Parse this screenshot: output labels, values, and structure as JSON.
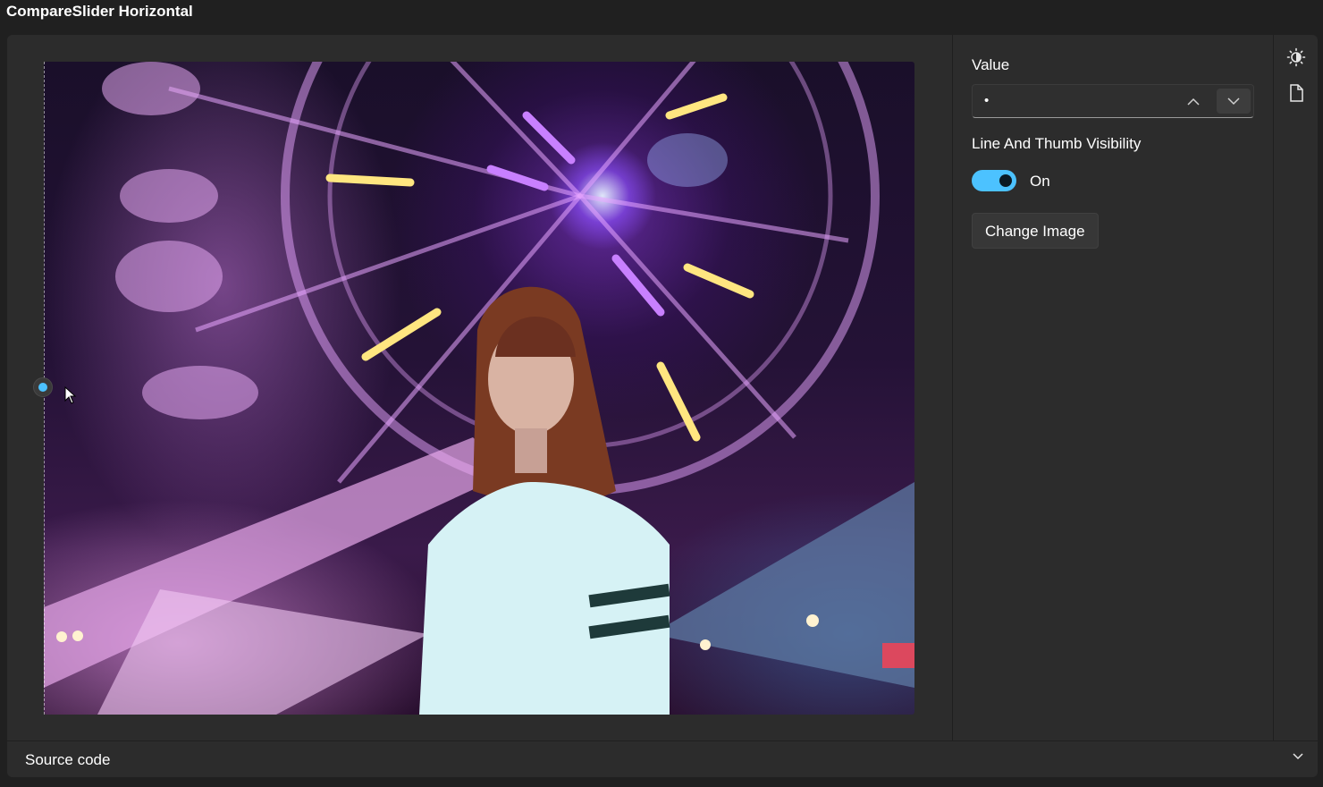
{
  "window": {
    "title": "CompareSlider Horizontal"
  },
  "example": {
    "image_description_name": "ferris-wheel-portrait",
    "line_visible": true
  },
  "options": {
    "value_label": "Value",
    "value": "•",
    "visibility_label": "Line And Thumb Visibility",
    "toggle_state": "On",
    "change_image_label": "Change Image"
  },
  "rail": {
    "icons": [
      "theme-icon",
      "document-icon"
    ]
  },
  "footer": {
    "source_code_label": "Source code"
  },
  "colors": {
    "accent": "#4cc2ff",
    "background": "#202020",
    "card": "#2c2c2c"
  }
}
